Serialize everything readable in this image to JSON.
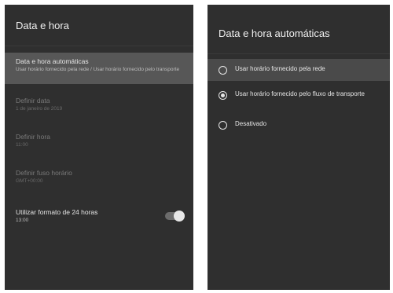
{
  "left": {
    "title": "Data e hora",
    "items": [
      {
        "title": "Data e hora automáticas",
        "subtitle": "Usar horário fornecido pela rede / Usar horário fornecido pelo transporte"
      },
      {
        "title": "Definir data",
        "subtitle": "1 de janeiro de 2019"
      },
      {
        "title": "Definir hora",
        "subtitle": "11:00"
      },
      {
        "title": "Definir fuso horário",
        "subtitle": "GMT+00:00"
      },
      {
        "title": "Utilizar formato de 24 horas",
        "subtitle": "13:00"
      }
    ],
    "toggle_on": true
  },
  "right": {
    "title": "Data e hora automáticas",
    "options": [
      {
        "label": "Usar horário fornecido pela rede",
        "checked": false
      },
      {
        "label": "Usar horário fornecido pelo fluxo de transporte",
        "checked": true
      },
      {
        "label": "Desativado",
        "checked": false
      }
    ]
  }
}
